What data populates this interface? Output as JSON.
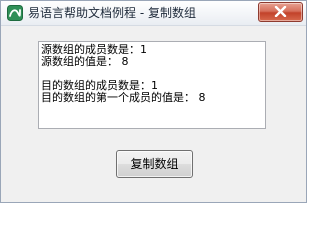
{
  "window": {
    "title": "易语言帮助文档例程 - 复制数组",
    "icon": "easy-language-app-icon",
    "close_icon": "close-icon"
  },
  "output": {
    "lines": [
      "源数组的成员数是：1",
      "源数组的值是： 8",
      "",
      "目的数组的成员数是：1",
      "目的数组的第一个成员的值是： 8"
    ]
  },
  "buttons": {
    "copy_label": "复制数组"
  },
  "colors": {
    "close_button": "#c2422a",
    "window_border": "#9aa6b8"
  }
}
